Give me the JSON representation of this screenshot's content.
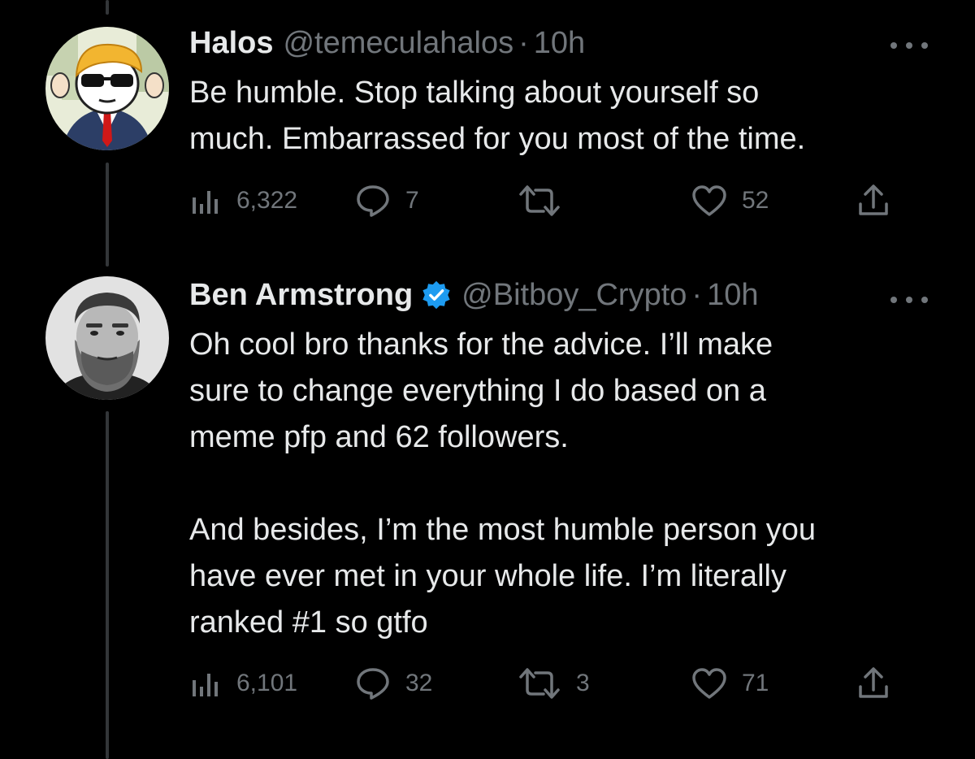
{
  "tweets": [
    {
      "display_name": "Halos",
      "handle": "@temeculahalos",
      "separator": "·",
      "time": "10h",
      "text": "Be humble. Stop talking about yourself so\nmuch. Embarrassed for you most of the time.",
      "views": "6,322",
      "replies": "7",
      "retweets": "",
      "likes": "52",
      "verified": false,
      "avatar_icon": "cartoon-man-sunglasses-suit-avatar"
    },
    {
      "display_name": "Ben Armstrong",
      "handle": "@Bitboy_Crypto",
      "separator": "·",
      "time": "10h",
      "text": "Oh cool bro thanks for the advice. I’ll make\nsure to change everything I do based on a\nmeme pfp and 62 followers.\n\nAnd besides, I’m the most humble person you\nhave ever met in your whole life. I’m literally\nranked #1 so gtfo",
      "views": "6,101",
      "replies": "32",
      "retweets": "3",
      "likes": "71",
      "verified": true,
      "avatar_icon": "bearded-man-portrait-avatar"
    }
  ],
  "colors": {
    "background": "#000000",
    "primary_text": "#e7e9ea",
    "secondary_text": "#71767b",
    "verified_badge": "#1d9bf0",
    "thread_line": "#333639"
  }
}
